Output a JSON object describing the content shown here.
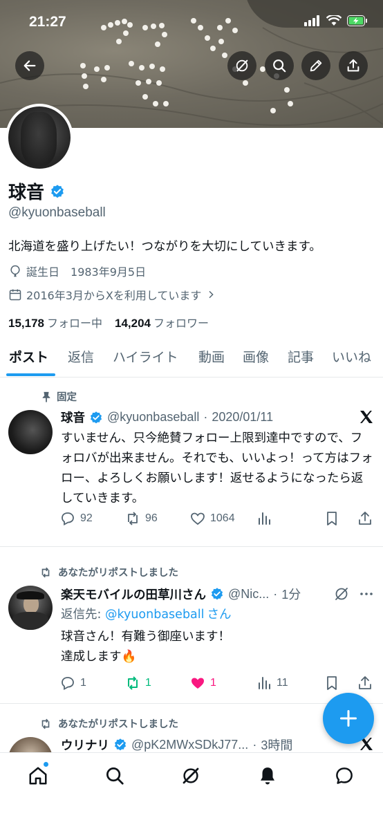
{
  "status_bar": {
    "time": "21:27"
  },
  "banner": {
    "text_line1": "ファン",
    "text_line2": "は宝物"
  },
  "profile": {
    "name": "球音",
    "handle": "@kyuonbaseball",
    "bio": "北海道を盛り上げたい！つながりを大切にしていきます。",
    "birthday_label": "誕生日",
    "birthday": "1983年9月5日",
    "joined": "2016年3月からXを利用しています",
    "following_count": "15,178",
    "following_label": "フォロー中",
    "followers_count": "14,204",
    "followers_label": "フォロワー"
  },
  "tabs": [
    "ポスト",
    "返信",
    "ハイライト",
    "動画",
    "画像",
    "記事",
    "いいね"
  ],
  "posts": [
    {
      "context": "固定",
      "name": "球音",
      "handle": "@kyuonbaseball",
      "date": "2020/01/11",
      "text": "すいません、只今絶賛フォロー上限到達中ですので、フォロバが出来ません。それでも、いいよっ！って方はフォロー、よろしくお願いします！返せるようになったら返していきます。",
      "replies": "92",
      "reposts": "96",
      "likes": "1064"
    },
    {
      "context": "あなたがリポストしました",
      "name": "楽天モバイルの田草川さん",
      "handle": "@Nic...",
      "date": "1分",
      "reply_prefix": "返信先: ",
      "reply_target": "@kyuonbaseball",
      "reply_suffix": "さん",
      "text_line1": "球音さん！有難う御座います！",
      "text_line2": "達成します🔥",
      "replies": "1",
      "reposts": "1",
      "likes": "1",
      "views": "11"
    },
    {
      "context": "あなたがリポストしました",
      "name": "ウリナリ",
      "handle": "@pK2MWxSDkJ77...",
      "date": "3時間"
    }
  ],
  "colors": {
    "accent": "#1d9bf0",
    "like": "#f91880",
    "repost": "#00ba7c",
    "secondary": "#536471"
  }
}
